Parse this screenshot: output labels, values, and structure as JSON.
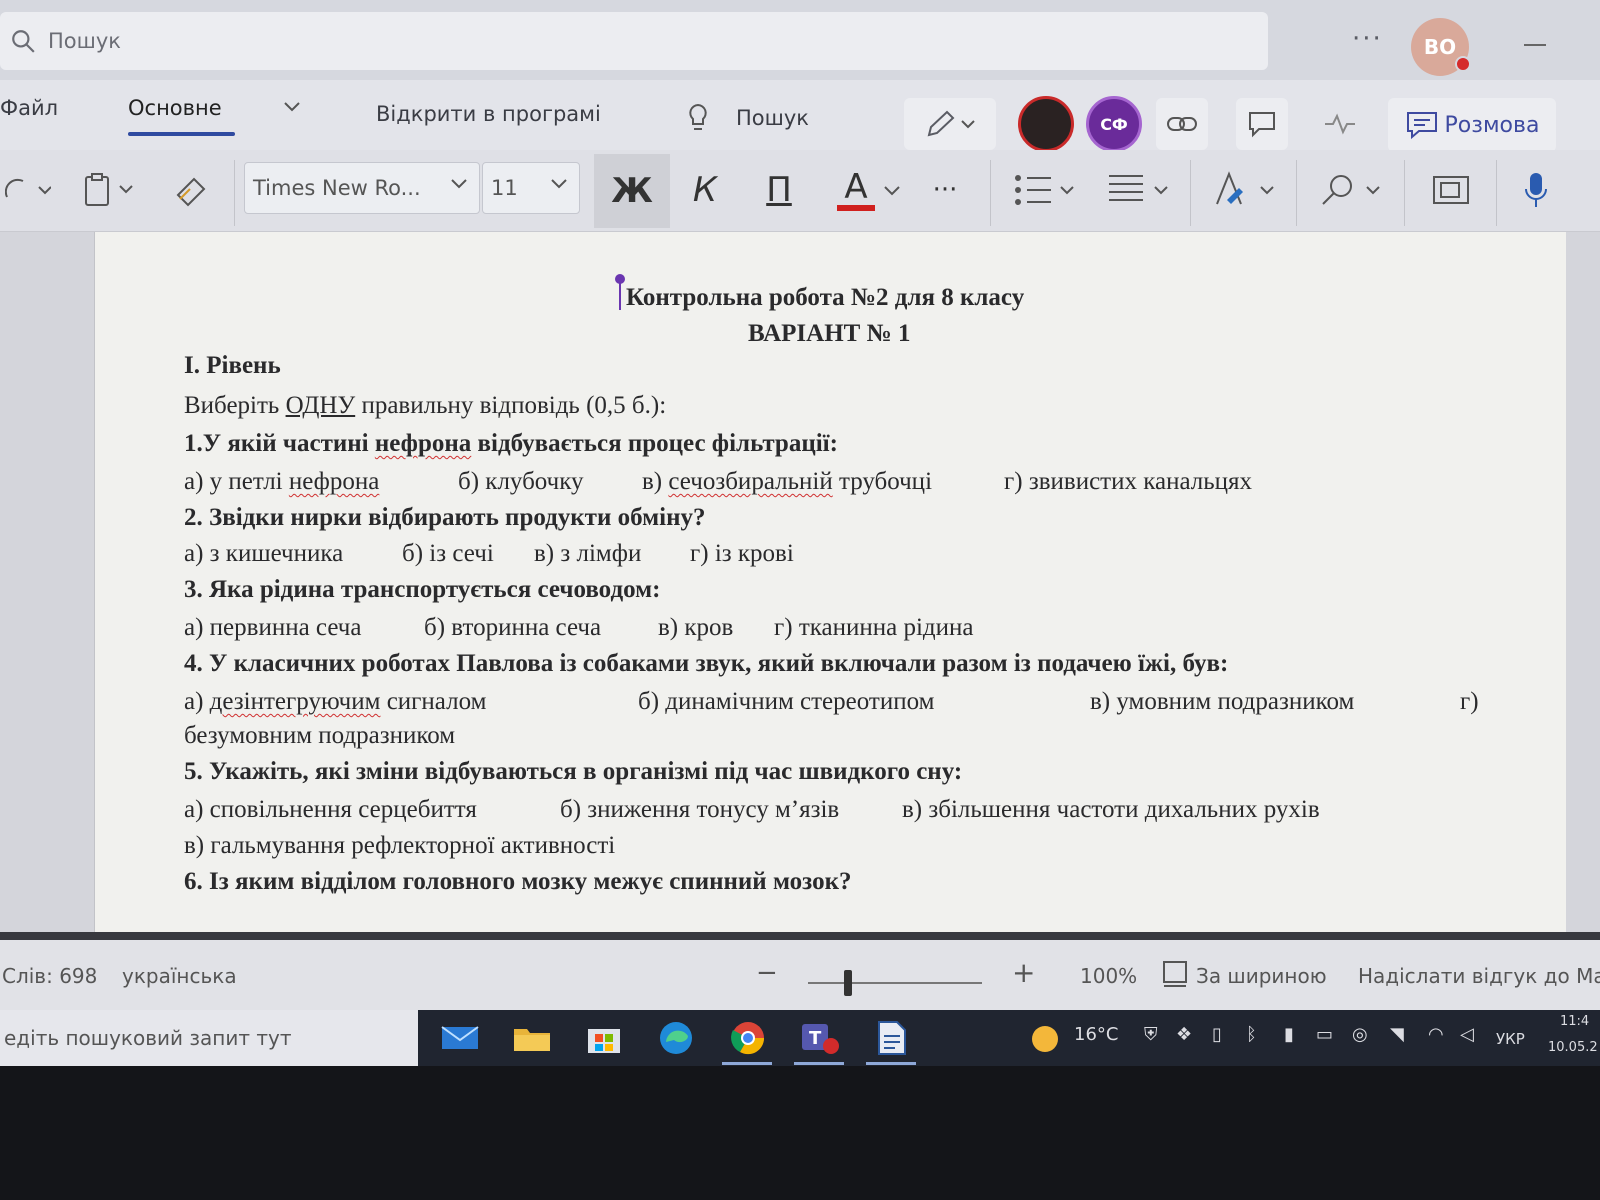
{
  "search": {
    "placeholder": "Пошук"
  },
  "user": {
    "initials": "ВО"
  },
  "tabs": {
    "file": "Файл",
    "home": "Основне",
    "open_in_app": "Відкрити в програмі",
    "tell_me": "Пошук",
    "chat": "Розмова",
    "collaborator_initials": "СФ"
  },
  "toolbar": {
    "font_name": "Times New Ro...",
    "font_size": "11",
    "bold": "Ж",
    "italic": "К",
    "underline": "П",
    "font_color": "А",
    "more": "···"
  },
  "document": {
    "title": "Контрольна робота №2 для 8 класу",
    "variant": "ВАРІАНТ № 1",
    "level": "I. Рівень",
    "instruction_pre": "Виберіть ",
    "instruction_underlined": "ОДНУ",
    "instruction_post": " правильну відповідь (0,5 б.):",
    "q1_pre": "1.У якій частині ",
    "q1_sq": "нефрона",
    "q1_post": " відбувається процес фільтрації:",
    "q1a_pre": "а) у петлі ",
    "q1a_sq": "нефрона",
    "q1b": "б) клубочку",
    "q1c_pre": "в) ",
    "q1c_sq": "сечозбиральній",
    "q1c_post": " трубочці",
    "q1d": "г) звивистих канальцях",
    "q2": "2. Звідки нирки відбирають продукти обміну?",
    "q2a": "а) з кишечника",
    "q2b": "б) із сечі",
    "q2c": "в) з лімфи",
    "q2d": "г) із крові",
    "q3": "3. Яка рідина транспортується сечоводом:",
    "q3a": "а) первинна сеча",
    "q3b": "б) вторинна сеча",
    "q3c": "в) кров",
    "q3d": "г) тканинна рідина",
    "q4": "4. У класичних роботах Павлова із собаками звук,  який включали разом із подачею їжі, був:",
    "q4a_pre": "а) ",
    "q4a_sq": "дезінтегруючим",
    "q4a_post": " сигналом",
    "q4b": "б) динамічним стереотипом",
    "q4c": "в) умовним подразником",
    "q4d_start": "г)",
    "q4d_rest": "безумовним подразником",
    "q5": "5. Укажіть, які зміни відбуваються в організмі під час швидкого сну:",
    "q5a": "а) сповільнення серцебиття",
    "q5b": "б) зниження тонусу м’язів",
    "q5c": "в) збільшення частоти дихальних рухів",
    "q5d": "в) гальмування рефлекторної активності",
    "q6": "6. Із яким відділом головного мозку межує спинний мозок?"
  },
  "status": {
    "words": "Слів: 698",
    "language": "українська",
    "zoom": "100%",
    "zoom_value": 100,
    "fit_width": "За шириною",
    "feedback": "Надіслати відгук до Май"
  },
  "taskbar": {
    "search_placeholder": "едіть пошуковий запит тут",
    "temperature": "16°C",
    "lang": "УКР",
    "time": "11:4",
    "date": "10.05.2"
  },
  "colors": {
    "accent": "#2f4aa0",
    "font_color_bar": "#d0201e",
    "collab_purple": "#6a2b9a",
    "cursor_purple": "#6a36b0"
  }
}
